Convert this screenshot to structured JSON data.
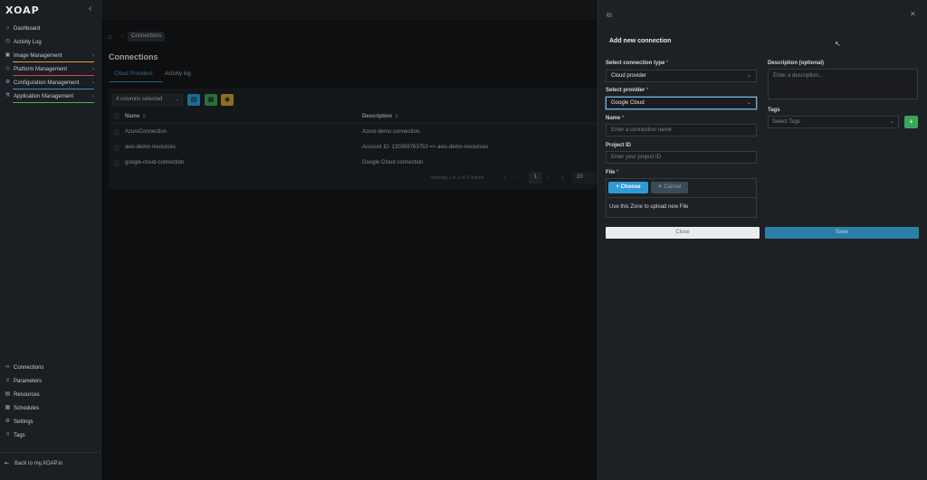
{
  "app": {
    "logo": "XOAP"
  },
  "sidebar": {
    "top_items": [
      {
        "label": "Dashboard",
        "icon": "home-icon"
      },
      {
        "label": "Activity Log",
        "icon": "clock-icon"
      },
      {
        "label": "Image Management",
        "icon": "image-icon",
        "accent": "#e0a030"
      },
      {
        "label": "Platform Management",
        "icon": "platform-icon",
        "accent": "#d04848"
      },
      {
        "label": "Configuration Management",
        "icon": "config-icon",
        "accent": "#3c8fd0"
      },
      {
        "label": "Application Management",
        "icon": "app-icon",
        "accent": "#4caf50"
      }
    ],
    "bottom_items": [
      {
        "label": "Connections",
        "icon": "link-icon"
      },
      {
        "label": "Parameters",
        "icon": "list-icon"
      },
      {
        "label": "Resources",
        "icon": "box-icon"
      },
      {
        "label": "Schedules",
        "icon": "calendar-icon"
      },
      {
        "label": "Settings",
        "icon": "gear-icon"
      },
      {
        "label": "Tags",
        "icon": "tag-icon"
      }
    ],
    "back_label": "Back to my.XOAP.io"
  },
  "breadcrumb": {
    "current": "Connections"
  },
  "page": {
    "title": "Connections"
  },
  "tabs": [
    {
      "label": "Cloud Providers",
      "active": true
    },
    {
      "label": "Activity log",
      "active": false
    }
  ],
  "table": {
    "columns_selected": "4 columns selected",
    "headers": [
      "Name",
      "Description"
    ],
    "rows": [
      {
        "name": "AzureConnection",
        "description": "Azure demo connection."
      },
      {
        "name": "aws-demo-resources",
        "description": "Account ID: 130059763753 => aws-demo-resources"
      },
      {
        "name": "google-cloud-connection",
        "description": "Google Cloud connection."
      }
    ],
    "pager": {
      "summary": "Showing 1 to 3 of 3 entries",
      "page": "1",
      "page_size": "20"
    }
  },
  "panel": {
    "title": "Add new connection",
    "connection_type": {
      "label": "Select connection type",
      "value": "Cloud provider"
    },
    "provider": {
      "label": "Select provider",
      "value": "Google Cloud"
    },
    "name": {
      "label": "Name",
      "placeholder": "Enter a connection name"
    },
    "project_id": {
      "label": "Project ID",
      "placeholder": "Enter your project ID"
    },
    "file": {
      "label": "File",
      "choose": "Choose",
      "cancel": "Cancel",
      "hint": "Use this Zone to upload new File"
    },
    "description": {
      "label": "Description (optional)",
      "placeholder": "Enter a description..."
    },
    "tags": {
      "label": "Tags",
      "placeholder": "Select Tags"
    },
    "close_label": "Close",
    "save_label": "Save"
  },
  "colors": {
    "accent": "#2f9bd6",
    "success": "#3aa65a",
    "warning": "#d4a52a",
    "save": "#2a7fa8"
  }
}
